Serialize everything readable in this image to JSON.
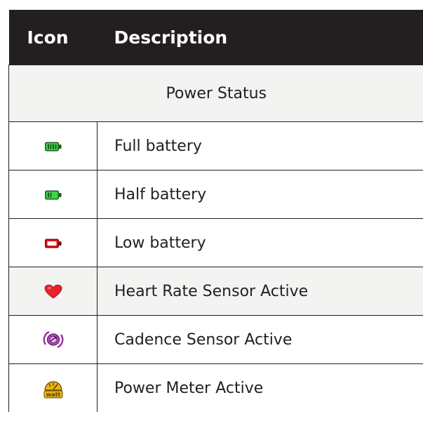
{
  "table": {
    "headers": {
      "icon": "Icon",
      "description": "Description"
    },
    "section_title": "Power Status",
    "rows": [
      {
        "icon": "full-battery-icon",
        "description": "Full battery"
      },
      {
        "icon": "half-battery-icon",
        "description": "Half battery"
      },
      {
        "icon": "low-battery-icon",
        "description": "Low battery"
      },
      {
        "icon": "heart-icon",
        "description": "Heart Rate Sensor Active"
      },
      {
        "icon": "cadence-sensor-icon",
        "description": "Cadence Sensor Active"
      },
      {
        "icon": "power-meter-icon",
        "description": "Power Meter Active",
        "icon_text": "watt"
      }
    ]
  },
  "colors": {
    "header_bg": "#231f20",
    "header_text": "#ffffff",
    "row_alt_bg": "#f3f3f2",
    "battery_green": "#2db83a",
    "battery_red": "#e1141d",
    "heart_red": "#e8222b",
    "cadence_purple": "#9b2fa3",
    "power_gold": "#e9b511"
  }
}
